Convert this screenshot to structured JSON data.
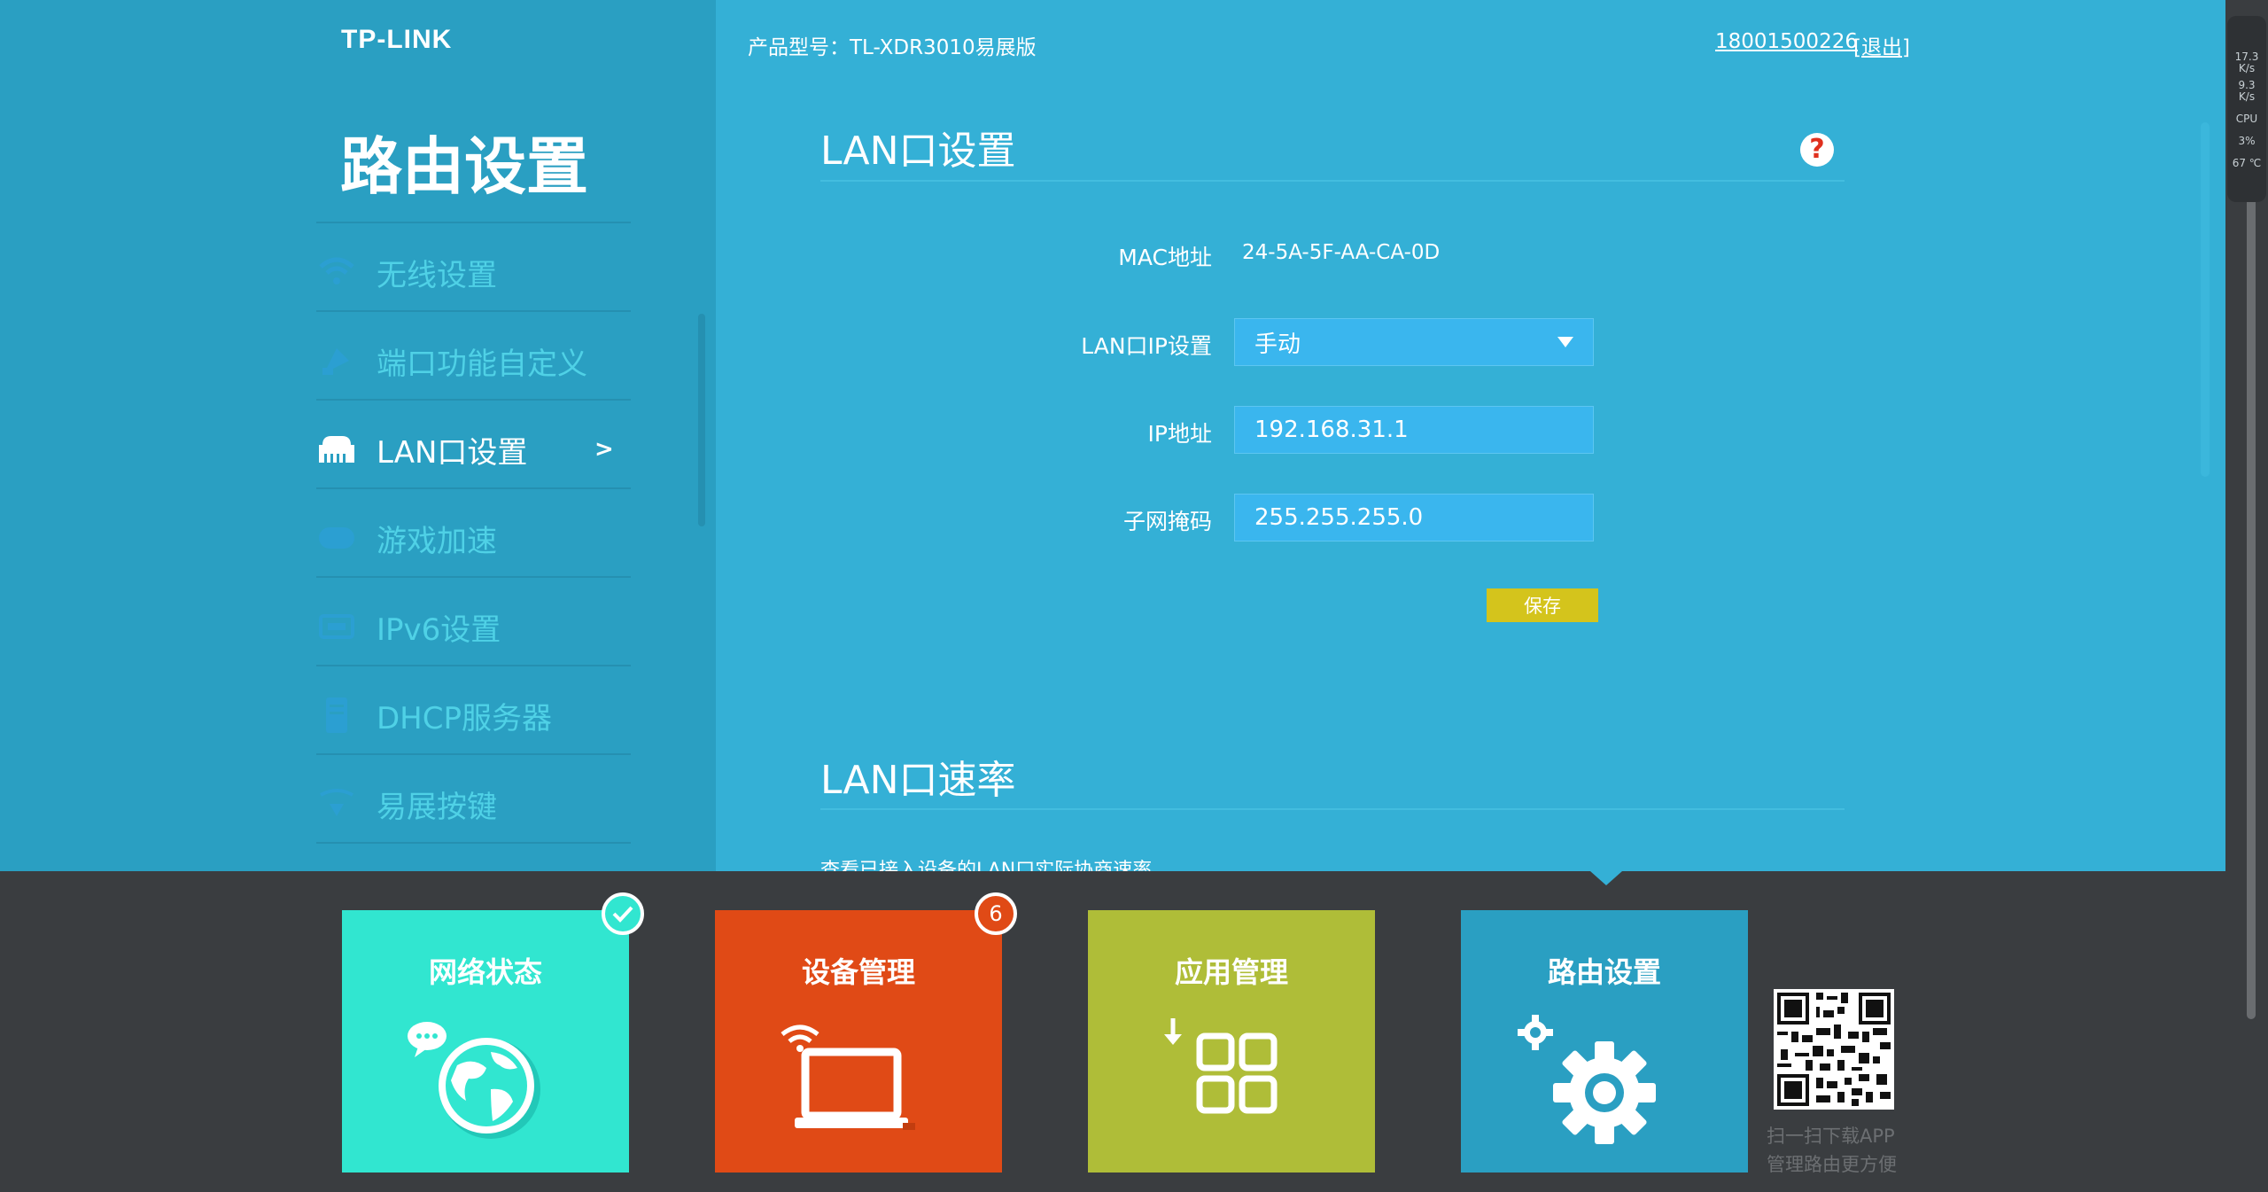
{
  "brand": {
    "logo": "TP-LINK"
  },
  "sidebar": {
    "title": "路由设置",
    "items": [
      {
        "label": "无线设置",
        "icon": "wifi-icon",
        "active": false
      },
      {
        "label": "端口功能自定义",
        "icon": "port-icon",
        "active": false
      },
      {
        "label": "LAN口设置",
        "icon": "lan-port-icon",
        "active": true,
        "chevron": ">"
      },
      {
        "label": "游戏加速",
        "icon": "gamepad-icon",
        "active": false
      },
      {
        "label": "IPv6设置",
        "icon": "ipv6-icon",
        "active": false
      },
      {
        "label": "DHCP服务器",
        "icon": "dhcp-icon",
        "active": false
      },
      {
        "label": "易展按键",
        "icon": "mesh-key-icon",
        "active": false
      }
    ]
  },
  "header": {
    "model": "产品型号：TL-XDR3010易展版",
    "account": "18001500226",
    "logout": "[退出]"
  },
  "lan_settings": {
    "title": "LAN口设置",
    "help": "?",
    "mac_label": "MAC地址",
    "mac_value": "24-5A-5F-AA-CA-0D",
    "ip_mode_label": "LAN口IP设置",
    "ip_mode_value": "手动",
    "ip_label": "IP地址",
    "ip_value": "192.168.31.1",
    "mask_label": "子网掩码",
    "mask_value": "255.255.255.0",
    "save_label": "保存"
  },
  "lan_rate": {
    "title": "LAN口速率",
    "description": "查看已接入设备的LAN口实际协商速率"
  },
  "dock": {
    "tiles": [
      {
        "label": "网络状态",
        "color": "#31e6d0"
      },
      {
        "label": "设备管理",
        "color": "#e04a16",
        "badge": "6"
      },
      {
        "label": "应用管理",
        "color": "#afbd38"
      },
      {
        "label": "路由设置",
        "color": "#2a9fc2"
      }
    ],
    "qr_text_line1": "扫一扫下载APP",
    "qr_text_line2": "管理路由更方便"
  },
  "monitor": {
    "up_speed": "17.3",
    "up_unit": "K/s",
    "down_speed": "9.3",
    "down_unit": "K/s",
    "cpu_label": "CPU",
    "cpu_value": "3%",
    "temp_value": "67 ℃"
  },
  "colors": {
    "sidebar_bg": "#2a9fc2",
    "content_bg": "#34b0d6",
    "dock_bg": "#3a3d40",
    "save_button": "#d4c41c",
    "inactive_menu": "#4fd1e6"
  }
}
